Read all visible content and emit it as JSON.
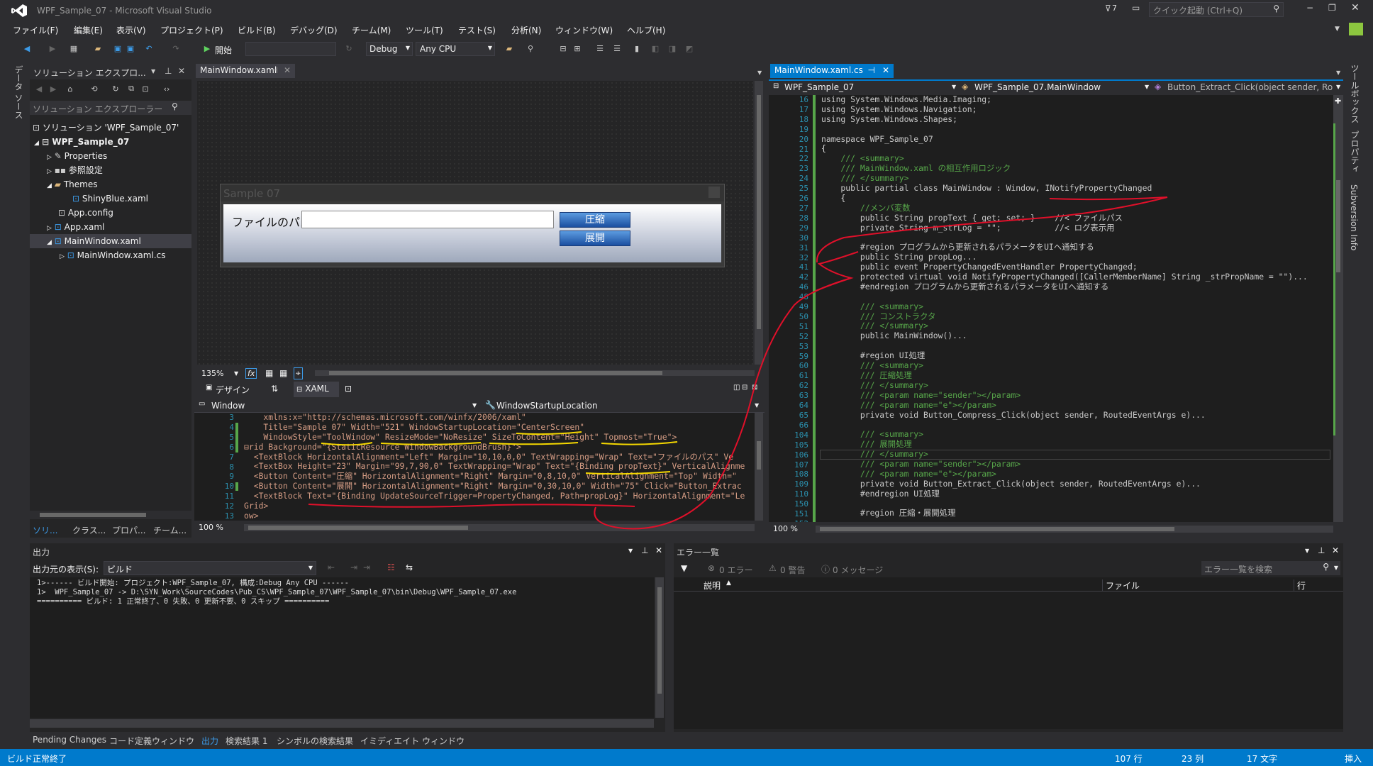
{
  "title": {
    "app": "WPF_Sample_07 - Microsoft Visual Studio",
    "notif": "7",
    "quick": "クイック起動 (Ctrl+Q)"
  },
  "menu": [
    "ファイル(F)",
    "編集(E)",
    "表示(V)",
    "プロジェクト(P)",
    "ビルド(B)",
    "デバッグ(D)",
    "チーム(M)",
    "ツール(T)",
    "テスト(S)",
    "分析(N)",
    "ウィンドウ(W)",
    "ヘルプ(H)"
  ],
  "toolbar": {
    "start": "開始",
    "config": "Debug",
    "platform": "Any CPU"
  },
  "left_vtabs": [
    "データ ソース"
  ],
  "right_vtabs": [
    "ツールボックス",
    "プロパティ",
    "Subversion Info"
  ],
  "solution": {
    "header": "ソリューション エクスプロ...",
    "search": "ソリューション エクスプローラー",
    "items": [
      "ソリューション 'WPF_Sample_07'",
      "WPF_Sample_07",
      "Properties",
      "参照設定",
      "Themes",
      "ShinyBlue.xaml",
      "App.config",
      "App.xaml",
      "MainWindow.xaml",
      "MainWindow.xaml.cs"
    ],
    "tabs": [
      "ソリ...",
      "クラス...",
      "プロパ...",
      "チーム..."
    ]
  },
  "designer": {
    "tab": "MainWindow.xaml",
    "win_title": "Sample 07",
    "label": "ファイルのパス",
    "btn1": "圧縮",
    "btn2": "展開",
    "zoom": "135%",
    "fx": "fx",
    "tab_design": "デザイン",
    "tab_xaml": "XAML",
    "scope_left": "Window",
    "scope_right": "WindowStartupLocation",
    "zoom2": "100 %"
  },
  "xaml": {
    "lines": [
      "3",
      "4",
      "5",
      "6",
      "7",
      "8",
      "9",
      "10",
      "11",
      "12",
      "13"
    ],
    "text": [
      "    xmlns:x=\"http://schemas.microsoft.com/winfx/2006/xaml\"",
      "    Title=\"Sample 07\" Width=\"521\" WindowStartupLocation=\"CenterScreen\"",
      "    WindowStyle=\"ToolWindow\" ResizeMode=\"NoResize\" SizeToContent=\"Height\" Topmost=\"True\">",
      "⊟rid Background=\"{StaticResource WindowBackgroundBrush}\">",
      "  <TextBlock HorizontalAlignment=\"Left\" Margin=\"10,10,0,0\" TextWrapping=\"Wrap\" Text=\"ファイルのパス\" Ve",
      "  <TextBox Height=\"23\" Margin=\"99,7,90,0\" TextWrapping=\"Wrap\" Text=\"{Binding propText}\" VerticalAlignme",
      "  <Button Content=\"圧縮\" HorizontalAlignment=\"Right\" Margin=\"0,8,10,0\" VerticalAlignment=\"Top\" Width=\"",
      "  <Button Content=\"展開\" HorizontalAlignment=\"Right\" Margin=\"0,30,10,0\" Width=\"75\" Click=\"Button_Extrac",
      "  <TextBlock Text=\"{Binding UpdateSourceTrigger=PropertyChanged, Path=propLog}\" HorizontalAlignment=\"Le",
      "Grid>",
      "ow>"
    ]
  },
  "cs": {
    "tab": "MainWindow.xaml.cs",
    "nav1": "WPF_Sample_07",
    "nav2": "WPF_Sample_07.MainWindow",
    "nav3": "Button_Extract_Click(object sender, Ro",
    "zoom": "100 %",
    "lines": [
      "16",
      "17",
      "18",
      "19",
      "20",
      "21",
      "22",
      "23",
      "24",
      "25",
      "26",
      "27",
      "28",
      "29",
      "30",
      "31",
      "32",
      "41",
      "42",
      "46",
      "48",
      "49",
      "50",
      "51",
      "52",
      "53",
      "59",
      "60",
      "61",
      "62",
      "63",
      "64",
      "65",
      "66",
      "104",
      "105",
      "106",
      "107",
      "108",
      "109",
      "110",
      "150",
      "151",
      "152"
    ],
    "text": [
      "using System.Windows.Media.Imaging;",
      "using System.Windows.Navigation;",
      "using System.Windows.Shapes;",
      "",
      "namespace WPF_Sample_07",
      "{",
      "    /// <summary>",
      "    /// MainWindow.xaml の相互作用ロジック",
      "    /// </summary>",
      "    public partial class MainWindow : Window, INotifyPropertyChanged",
      "    {",
      "        //メンバ変数",
      "        public String propText { get; set; }    //< ファイルパス",
      "        private String m_strLog = \"\";           //< ログ表示用",
      "",
      "        #region プログラムから更新されるパラメータをUIへ通知する",
      "        public String propLog...",
      "        public event PropertyChangedEventHandler PropertyChanged;",
      "        protected virtual void NotifyPropertyChanged([CallerMemberName] String _strPropName = \"\")...",
      "        #endregion プログラムから更新されるパラメータをUIへ通知する",
      "",
      "        /// <summary>",
      "        /// コンストラクタ",
      "        /// </summary>",
      "        public MainWindow()...",
      "",
      "        #region UI処理",
      "        /// <summary>",
      "        /// 圧縮処理",
      "        /// </summary>",
      "        /// <param name=\"sender\"></param>",
      "        /// <param name=\"e\"></param>",
      "        private void Button_Compress_Click(object sender, RoutedEventArgs e)...",
      "",
      "        /// <summary>",
      "        /// 展開処理",
      "        /// </summary>",
      "        /// <param name=\"sender\"></param>",
      "        /// <param name=\"e\"></param>",
      "        private void Button_Extract_Click(object sender, RoutedEventArgs e)...",
      "        #endregion UI処理",
      "",
      "        #region 圧縮・展開処理"
    ]
  },
  "output": {
    "title": "出力",
    "source_label": "出力元の表示(S):",
    "source": "ビルド",
    "lines": [
      "1>------ ビルド開始: プロジェクト:WPF_Sample_07, 構成:Debug Any CPU ------",
      "1>  WPF_Sample_07 -> D:\\SYN_Work\\SourceCodes\\Pub_CS\\WPF_Sample_07\\WPF_Sample_07\\bin\\Debug\\WPF_Sample_07.exe",
      "========== ビルド: 1 正常終了、0 失敗、0 更新不要、0 スキップ =========="
    ]
  },
  "errors": {
    "title": "エラー一覧",
    "errors": "0 エラー",
    "warnings": "0 警告",
    "messages": "0 メッセージ",
    "search": "エラー一覧を検索",
    "col_desc": "説明",
    "col_file": "ファイル",
    "col_line": "行"
  },
  "bottom_tabs": [
    "Pending Changes",
    "コード定義ウィンドウ",
    "出力",
    "検索結果 1",
    "シンボルの検索結果",
    "イミディエイト ウィンドウ"
  ],
  "status": {
    "left": "ビルド正常終了",
    "row": "107 行",
    "col": "23 列",
    "chars": "17 文字",
    "mode": "挿入"
  },
  "colors": {
    "accent": "#007acc",
    "bg": "#2d2d30",
    "editor": "#1e1e1e",
    "annot_red": "#e0102a",
    "annot_yellow": "#f5d800"
  }
}
